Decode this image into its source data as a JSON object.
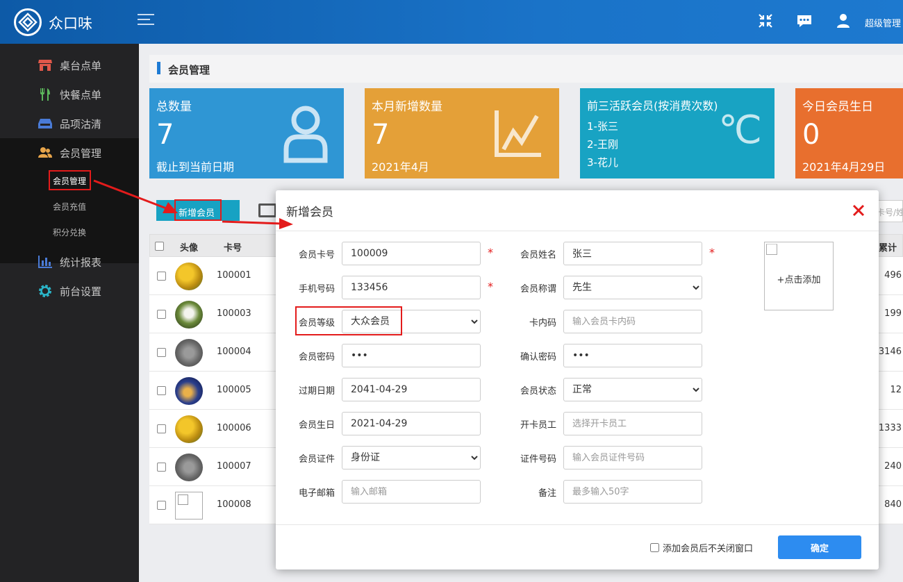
{
  "app": {
    "brand": "众口味",
    "admin_label": "超级管理"
  },
  "sidebar": {
    "items": [
      {
        "label": "桌台点单",
        "icon": "store-icon"
      },
      {
        "label": "快餐点单",
        "icon": "utensils-icon"
      },
      {
        "label": "品项沽清",
        "icon": "box-icon"
      },
      {
        "label": "会员管理",
        "icon": "users-icon"
      },
      {
        "label": "统计报表",
        "icon": "bar-chart-icon"
      },
      {
        "label": "前台设置",
        "icon": "gear-icon"
      }
    ],
    "sub_items": [
      {
        "label": "会员管理"
      },
      {
        "label": "会员充值"
      },
      {
        "label": "积分兑换"
      }
    ]
  },
  "page": {
    "title": "会员管理"
  },
  "cards": [
    {
      "title": "总数量",
      "value": "7",
      "sub": "截止到当前日期",
      "color": "#2f96d4"
    },
    {
      "title": "本月新增数量",
      "value": "7",
      "sub": "2021年4月",
      "color": "#e4a038"
    },
    {
      "title": "前三活跃会员(按消费次数)",
      "lines": [
        "1-张三",
        "2-王刚",
        "3-花儿"
      ],
      "unit": "℃",
      "color": "#18a3c3"
    },
    {
      "title": "今日会员生日",
      "value": "0",
      "sub": "2021年4月29日",
      "color": "#e86f2e"
    }
  ],
  "toolbar": {
    "add_label": "新增会员",
    "search_placeholder": "卡号/姓"
  },
  "table": {
    "headers": {
      "avatar": "头像",
      "card_no": "卡号",
      "total": "累计"
    },
    "rows": [
      {
        "card_no": "100001",
        "total": "496"
      },
      {
        "card_no": "100003",
        "total": "199"
      },
      {
        "card_no": "100004",
        "total": "3146"
      },
      {
        "card_no": "100005",
        "total": "12"
      },
      {
        "card_no": "100006",
        "total": "1333"
      },
      {
        "card_no": "100007",
        "total": "240"
      },
      {
        "card_no": "100008",
        "total": "840"
      }
    ]
  },
  "modal": {
    "title": "新增会员",
    "card_no": {
      "label": "会员卡号",
      "value": "100009"
    },
    "name": {
      "label": "会员姓名",
      "value": "张三"
    },
    "phone": {
      "label": "手机号码",
      "value": "133456"
    },
    "title_select": {
      "label": "会员称谓",
      "value": "先生"
    },
    "level": {
      "label": "会员等级",
      "value": "大众会员"
    },
    "card_code": {
      "label": "卡内码",
      "placeholder": "输入会员卡内码"
    },
    "password": {
      "label": "会员密码",
      "value": "•••"
    },
    "confirm_password": {
      "label": "确认密码",
      "value": "•••"
    },
    "expire": {
      "label": "过期日期",
      "value": "2041-04-29"
    },
    "status": {
      "label": "会员状态",
      "value": "正常"
    },
    "birthday": {
      "label": "会员生日",
      "value": "2021-04-29"
    },
    "staff": {
      "label": "开卡员工",
      "placeholder": "选择开卡员工"
    },
    "id_type": {
      "label": "会员证件",
      "value": "身份证"
    },
    "id_no": {
      "label": "证件号码",
      "placeholder": "输入会员证件号码"
    },
    "email": {
      "label": "电子邮箱",
      "placeholder": "输入邮箱"
    },
    "remark": {
      "label": "备注",
      "placeholder": "最多输入50字"
    },
    "photo_label": "+点击添加",
    "keep_open_label": "添加会员后不关闭窗口",
    "confirm_label": "确定",
    "required_mark": "*"
  }
}
